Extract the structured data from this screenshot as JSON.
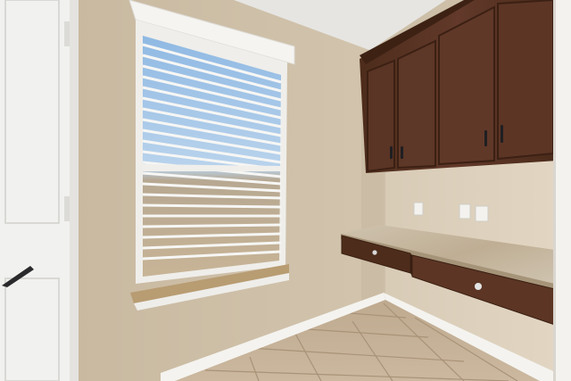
{
  "scene": {
    "description_tag": "",
    "colors": {
      "wall_left": "#cbbca5",
      "wall_right": "#d6c8b2",
      "ceiling": "#e8e6e2",
      "cabinet_dark": "#4a2a1a",
      "cabinet_mid": "#5e3826",
      "countertop": "#c9bca6",
      "floor_tile": "#c7b39a",
      "trim_white": "#f3f2ee",
      "door_white": "#f2f2f0",
      "window_sky": "#9cc2e6",
      "blind_white": "#f4f4f2"
    },
    "icons": [
      "door-handle-icon",
      "cabinet-pull-icon",
      "drawer-knob-icon",
      "outlet-icon"
    ]
  }
}
